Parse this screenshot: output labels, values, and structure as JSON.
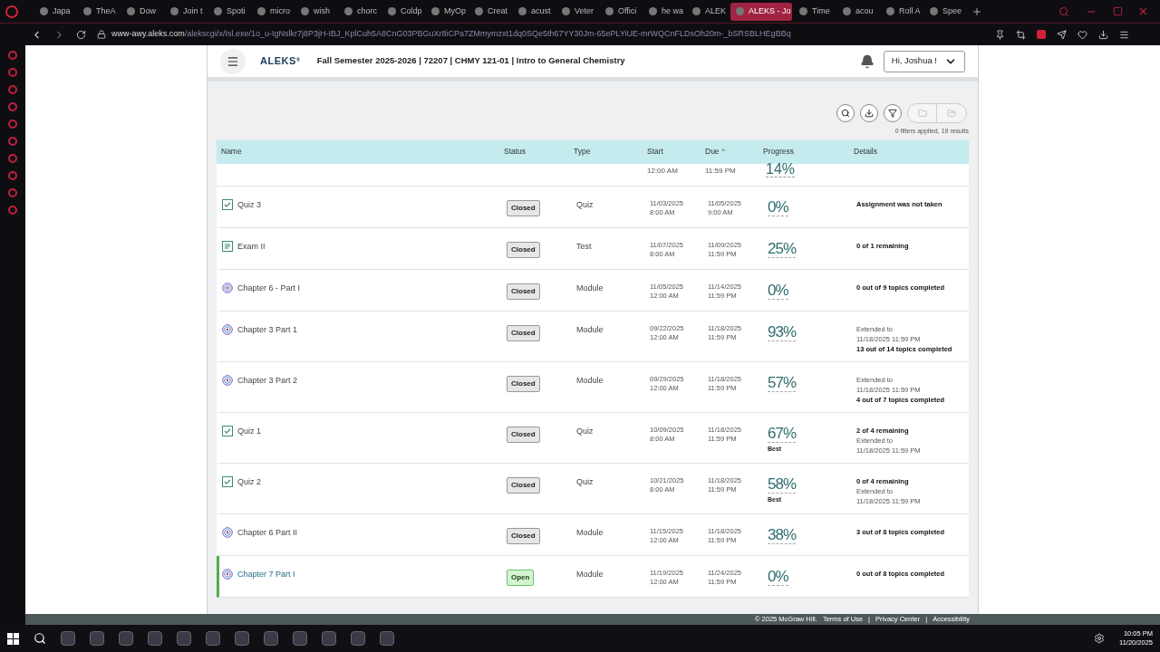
{
  "browser": {
    "tabs": [
      {
        "label": "Japa",
        "selected": false
      },
      {
        "label": "TheA",
        "selected": false
      },
      {
        "label": "Dow",
        "selected": false
      },
      {
        "label": "Join t",
        "selected": false
      },
      {
        "label": "Spoti",
        "selected": false
      },
      {
        "label": "micro",
        "selected": false
      },
      {
        "label": "wish",
        "selected": false
      },
      {
        "label": "chorc",
        "selected": false
      },
      {
        "label": "Coldp",
        "selected": false
      },
      {
        "label": "MyOp",
        "selected": false
      },
      {
        "label": "Creat",
        "selected": false
      },
      {
        "label": "acust",
        "selected": false
      },
      {
        "label": "Veter",
        "selected": false
      },
      {
        "label": "Offici",
        "selected": false
      },
      {
        "label": "he wa",
        "selected": false
      },
      {
        "label": "ALEK",
        "selected": false
      },
      {
        "label": "ALEKS - Jo",
        "selected": true
      },
      {
        "label": "Time",
        "selected": false
      },
      {
        "label": "acou",
        "selected": false
      },
      {
        "label": "Roll A",
        "selected": false
      },
      {
        "label": "Spee",
        "selected": false
      }
    ],
    "url_host": "www-awy.aleks.com",
    "url_path": "/alekscgi/x/Isl.exe/1o_u-IgNslkr7j8P3jH-IBJ_KplCuh5A8CnG03PBGuXr8iCPa7ZMmymzxt1dq0SQe5th67YY30Jm-65ePLYiUE-mrWQCnFLDsOh20m-_bSRSBLHEgBBq"
  },
  "header": {
    "logo": "ALEKS",
    "logo_mark": "®",
    "course": "Fall Semester 2025-2026 | 72207 | CHMY 121-01 | Intro to General Chemistry",
    "user": "Hi, Joshua !"
  },
  "results": "0 filters applied, 19 results",
  "table": {
    "columns": [
      "Name",
      "Status",
      "Type",
      "Start",
      "Due",
      "Progress",
      "Details"
    ],
    "sort_mark": "^",
    "rows": [
      {
        "kind": "partial",
        "start": "12:00 AM",
        "due": "11:59 PM",
        "progress": "14%"
      },
      {
        "kind": "quiz",
        "name": "Quiz 3",
        "status": "Closed",
        "open": false,
        "selected": false,
        "type": "Quiz",
        "start": [
          "11/03/2025",
          "8:00 AM"
        ],
        "due": [
          "11/05/2025",
          "9:00 AM"
        ],
        "progress": "0%",
        "details": [
          {
            "text": "Assignment was not taken",
            "bold": true
          }
        ]
      },
      {
        "kind": "test",
        "name": "Exam II",
        "status": "Closed",
        "open": false,
        "selected": false,
        "type": "Test",
        "start": [
          "11/07/2025",
          "8:00 AM"
        ],
        "due": [
          "11/09/2025",
          "11:59 PM"
        ],
        "progress": "25%",
        "details": [
          {
            "text": "0 of 1 remaining",
            "bold": true
          }
        ]
      },
      {
        "kind": "module",
        "name": "Chapter 6 - Part I",
        "status": "Closed",
        "open": false,
        "selected": false,
        "type": "Module",
        "start": [
          "11/05/2025",
          "12:00 AM"
        ],
        "due": [
          "11/14/2025",
          "11:59 PM"
        ],
        "progress": "0%",
        "details": [
          {
            "text": "0 out of 9 topics completed",
            "bold": true
          }
        ]
      },
      {
        "kind": "module",
        "name": "Chapter 3 Part 1",
        "status": "Closed",
        "open": false,
        "selected": false,
        "type": "Module",
        "start": [
          "09/22/2025",
          "12:00 AM"
        ],
        "due": [
          "11/18/2025",
          "11:59 PM"
        ],
        "progress": "93%",
        "details": [
          {
            "text": "Extended to",
            "bold": false
          },
          {
            "text": "11/18/2025 11:59 PM",
            "bold": false
          },
          {
            "text": "13 out of 14 topics completed",
            "bold": true
          }
        ]
      },
      {
        "kind": "module",
        "name": "Chapter 3 Part 2",
        "status": "Closed",
        "open": false,
        "selected": false,
        "type": "Module",
        "start": [
          "09/29/2025",
          "12:00 AM"
        ],
        "due": [
          "11/18/2025",
          "11:59 PM"
        ],
        "progress": "57%",
        "details": [
          {
            "text": "Extended to",
            "bold": false
          },
          {
            "text": "11/18/2025 11:59 PM",
            "bold": false
          },
          {
            "text": "4 out of 7 topics completed",
            "bold": true
          }
        ]
      },
      {
        "kind": "quiz",
        "name": "Quiz 1",
        "status": "Closed",
        "open": false,
        "selected": false,
        "type": "Quiz",
        "start": [
          "10/09/2025",
          "8:00 AM"
        ],
        "due": [
          "11/18/2025",
          "11:59 PM"
        ],
        "progress": "67%",
        "best": "Best",
        "details": [
          {
            "text": "2 of 4 remaining",
            "bold": true
          },
          {
            "text": "Extended to",
            "bold": false
          },
          {
            "text": "11/18/2025 11:59 PM",
            "bold": false
          }
        ]
      },
      {
        "kind": "quiz",
        "name": "Quiz 2",
        "status": "Closed",
        "open": false,
        "selected": false,
        "type": "Quiz",
        "start": [
          "10/21/2025",
          "8:00 AM"
        ],
        "due": [
          "11/18/2025",
          "11:59 PM"
        ],
        "progress": "58%",
        "best": "Best",
        "details": [
          {
            "text": "0 of 4 remaining",
            "bold": true
          },
          {
            "text": "Extended to",
            "bold": false
          },
          {
            "text": "11/18/2025 11:59 PM",
            "bold": false
          }
        ]
      },
      {
        "kind": "module",
        "name": "Chapter 6 Part II",
        "status": "Closed",
        "open": false,
        "selected": false,
        "type": "Module",
        "start": [
          "11/15/2025",
          "12:00 AM"
        ],
        "due": [
          "11/18/2025",
          "11:59 PM"
        ],
        "progress": "38%",
        "details": [
          {
            "text": "3 out of 8 topics completed",
            "bold": true
          }
        ]
      },
      {
        "kind": "module",
        "name": "Chapter 7 Part I",
        "status": "Open",
        "open": true,
        "selected": true,
        "type": "Module",
        "start": [
          "11/19/2025",
          "12:00 AM"
        ],
        "due": [
          "11/24/2025",
          "11:59 PM"
        ],
        "progress": "0%",
        "details": [
          {
            "text": "0 out of 8 topics completed",
            "bold": true
          }
        ]
      }
    ]
  },
  "footer": {
    "copyright": "© 2025 McGraw Hill.",
    "links": [
      "Terms of Use",
      "Privacy Center",
      "Accessibility"
    ],
    "separator": "|"
  },
  "taskbar": {
    "time": "10:05 PM",
    "date": "11/20/2025"
  }
}
